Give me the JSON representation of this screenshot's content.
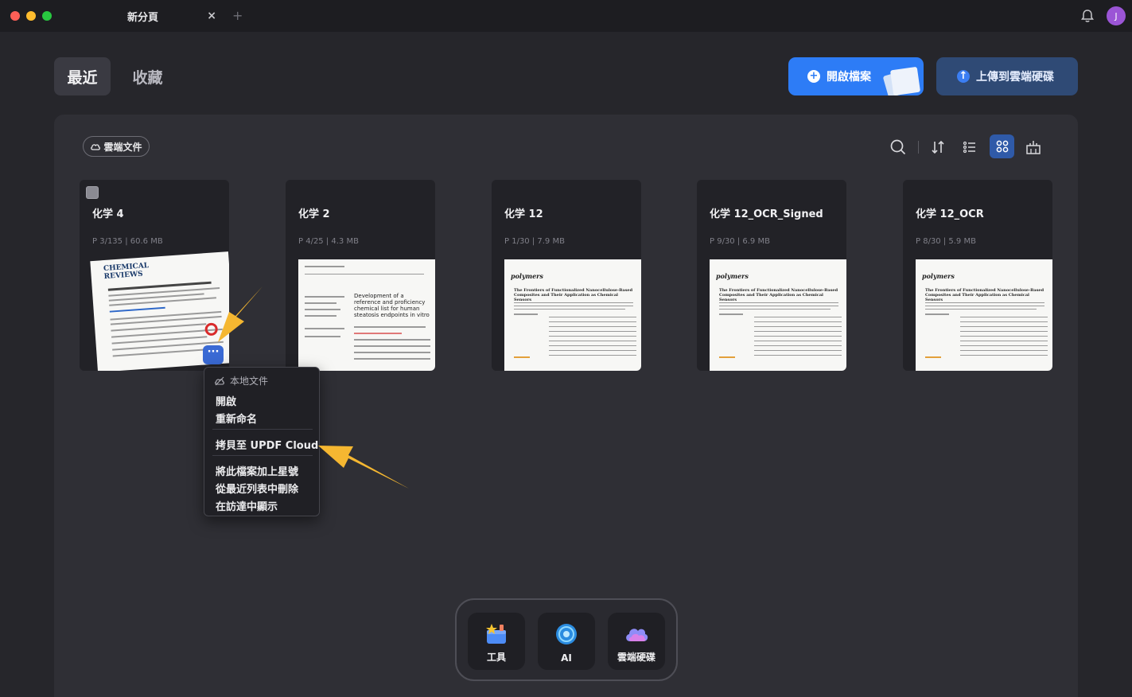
{
  "window": {
    "tab_title": "新分頁",
    "tab_close": "×",
    "tab_add": "+",
    "avatar_initial": "J"
  },
  "header": {
    "tab_recent": "最近",
    "tab_favorites": "收藏",
    "open_file": "開啟檔案",
    "upload_cloud": "上傳到雲端硬碟"
  },
  "toolbar": {
    "cloud_docs": "雲端文件",
    "icons": [
      "search-icon",
      "sort-icon",
      "list-view-icon",
      "grid-view-icon",
      "clear-icon"
    ]
  },
  "files": [
    {
      "name": "化学 4",
      "meta": "P 3/135  |  60.6 MB",
      "thumb": "chemical-reviews"
    },
    {
      "name": "化学 2",
      "meta": "P 4/25  |  4.3 MB",
      "thumb": "reference"
    },
    {
      "name": "化学 12",
      "meta": "P 1/30  |  7.9 MB",
      "thumb": "polymers"
    },
    {
      "name": "化学 12_OCR_Signed",
      "meta": "P 9/30  |  6.9 MB",
      "thumb": "polymers"
    },
    {
      "name": "化学 12_OCR",
      "meta": "P 8/30  |  5.9 MB",
      "thumb": "polymers"
    }
  ],
  "thumbs": {
    "chem_reviews": "CHEMICAL REVIEWS",
    "ref_title": "Development of a reference and proficiency chemical list for human steatosis endpoints in vitro",
    "polymers": "polymers",
    "polymers_title": "The Frontiers of Functionalized Nanocellulose-Based Composites and Their Application as Chemical Sensors"
  },
  "more_button": "···",
  "context_menu": {
    "header": "本地文件",
    "open": "開啟",
    "rename": "重新命名",
    "copy_to_cloud": "拷貝至 UPDF Cloud",
    "star": "將此檔案加上星號",
    "remove_recent": "從最近列表中刪除",
    "show_in_finder": "在訪達中顯示"
  },
  "dock": {
    "tools": "工具",
    "ai": "AI",
    "cloud_drive": "雲端硬碟"
  },
  "colors": {
    "accent": "#2d7cf6",
    "arrow": "#f5b731",
    "background": "#26262b"
  }
}
